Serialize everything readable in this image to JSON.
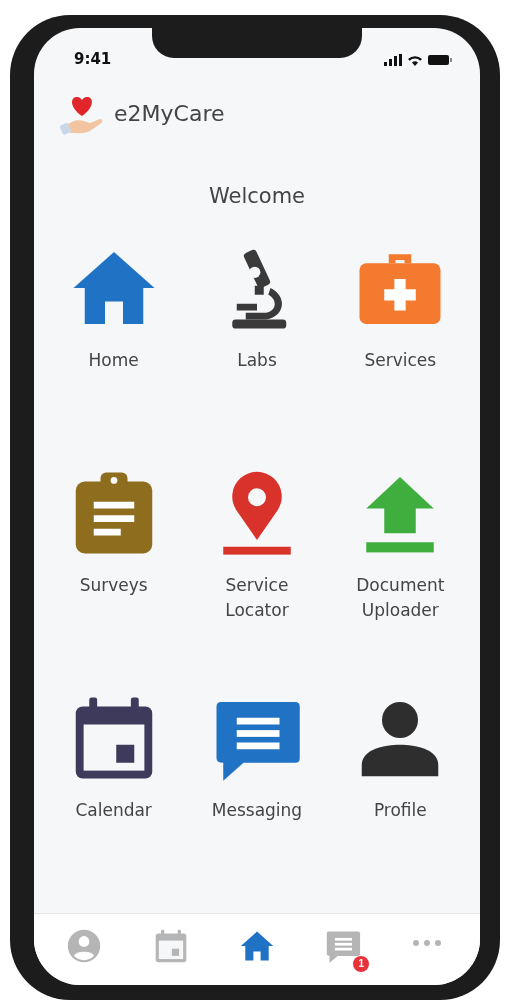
{
  "status_bar": {
    "time": "9:41"
  },
  "app": {
    "name": "e2MyCare"
  },
  "heading": "Welcome",
  "tiles": [
    {
      "kind": "home",
      "label": "Home",
      "color": "#1f72c4"
    },
    {
      "kind": "microscope",
      "label": "Labs",
      "color": "#3a3a3a"
    },
    {
      "kind": "medkit",
      "label": "Services",
      "color": "#f47a30"
    },
    {
      "kind": "clipboard",
      "label": "Surveys",
      "color": "#8e6d1f"
    },
    {
      "kind": "pin",
      "label": "Service Locator",
      "color": "#d9322b"
    },
    {
      "kind": "upload",
      "label": "Document Uploader",
      "color": "#3fae3f"
    },
    {
      "kind": "calendar",
      "label": "Calendar",
      "color": "#3d3a5c"
    },
    {
      "kind": "message",
      "label": "Messaging",
      "color": "#1f72c4"
    },
    {
      "kind": "person",
      "label": "Profile",
      "color": "#2e2e2e"
    }
  ],
  "tab_bar": [
    {
      "kind": "person",
      "selected": false
    },
    {
      "kind": "calendar",
      "selected": false
    },
    {
      "kind": "home",
      "selected": true
    },
    {
      "kind": "message",
      "selected": false,
      "badge": "1"
    },
    {
      "kind": "more",
      "selected": false
    }
  ]
}
